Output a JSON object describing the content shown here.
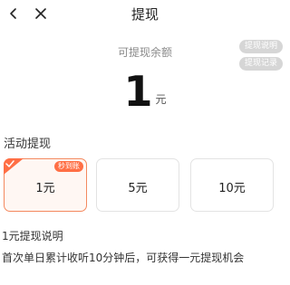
{
  "header": {
    "title": "提现",
    "back_icon": "chevron-left-icon",
    "close_icon": "close-icon"
  },
  "balance": {
    "label": "可提现余额",
    "amount": "1",
    "unit": "元"
  },
  "side_buttons": {
    "details": "提现说明",
    "records": "提现记录"
  },
  "activity": {
    "section_title": "活动提现",
    "options": [
      {
        "label": "1元",
        "selected": true,
        "badge": "秒到账"
      },
      {
        "label": "5元",
        "selected": false
      },
      {
        "label": "10元",
        "selected": false
      }
    ]
  },
  "description": {
    "title": "1元提现说明",
    "text": "首次单日累计收听10分钟后，可获得一元提现机会"
  },
  "colors": {
    "accent": "#ff6f45",
    "selected_border": "#f4895f",
    "pill_bg": "#d6d6d6"
  }
}
